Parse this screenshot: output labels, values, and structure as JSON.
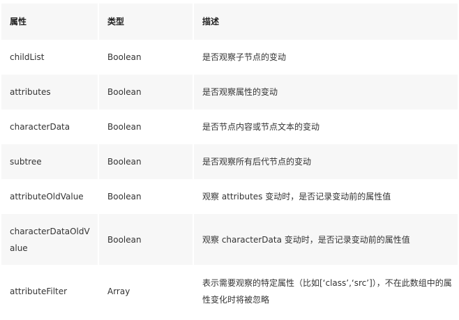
{
  "table": {
    "headers": [
      "属性",
      "类型",
      "描述"
    ],
    "rows": [
      {
        "name": "childList",
        "type": "Boolean",
        "desc": "是否观察子节点的变动"
      },
      {
        "name": "attributes",
        "type": "Boolean",
        "desc": "是否观察属性的变动"
      },
      {
        "name": "characterData",
        "type": "Boolean",
        "desc": "是否节点内容或节点文本的变动"
      },
      {
        "name": "subtree",
        "type": "Boolean",
        "desc": "是否观察所有后代节点的变动"
      },
      {
        "name": "attributeOldValue",
        "type": "Boolean",
        "desc": "观察 attributes 变动时，是否记录变动前的属性值"
      },
      {
        "name": "characterDataOldValue",
        "type": "Boolean",
        "desc": "观察 characterData 变动时，是否记录变动前的属性值"
      },
      {
        "name": "attributeFilter",
        "type": "Array",
        "desc": "表示需要观察的特定属性（比如[‘class’,‘src’]），不在此数组中的属性变化时将被忽略"
      }
    ]
  }
}
